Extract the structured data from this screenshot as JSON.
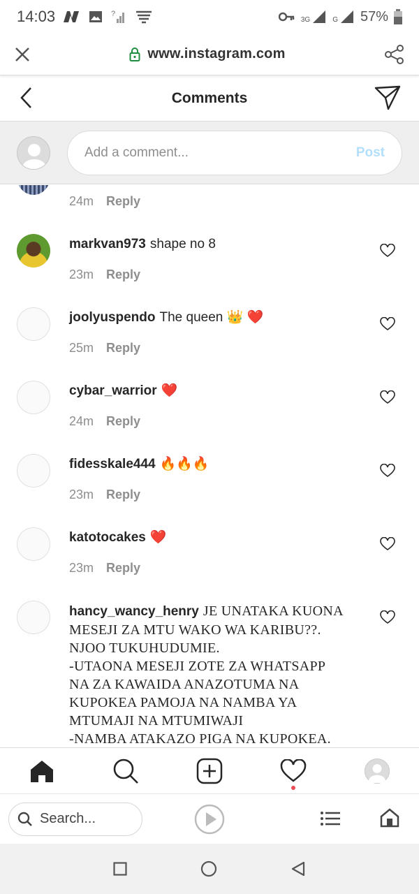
{
  "status_bar": {
    "time": "14:03",
    "network_labels": [
      "3G",
      "G"
    ],
    "battery": "57%"
  },
  "browser": {
    "url": "www.instagram.com",
    "search_placeholder": "Search...",
    "icons": [
      "close-icon",
      "lock-icon",
      "share-icon",
      "search-icon",
      "play-icon",
      "tabs-menu-icon",
      "home-icon"
    ]
  },
  "header": {
    "title": "Comments"
  },
  "add_comment": {
    "placeholder": "Add a comment...",
    "post_label": "Post"
  },
  "first_partial": {
    "time": "24m",
    "reply": "Reply"
  },
  "comments": [
    {
      "username": "markvan973",
      "text": "shape no 8",
      "time": "23m",
      "reply": "Reply"
    },
    {
      "username": "joolyuspendo",
      "text": "The queen 👑 ❤️",
      "time": "25m",
      "reply": "Reply"
    },
    {
      "username": "cybar_warrior",
      "text": "❤️",
      "time": "24m",
      "reply": "Reply"
    },
    {
      "username": "fidesskale444",
      "text": "🔥🔥🔥",
      "time": "23m",
      "reply": "Reply"
    },
    {
      "username": "katotocakes",
      "text": "❤️",
      "time": "23m",
      "reply": "Reply"
    }
  ],
  "long_comment": {
    "username": "hancy_wancy_henry",
    "lines": [
      "JE UNATAKA KUONA",
      "MESEJI ZA MTU WAKO WA KARIBU??.",
      "NJOO TUKUHUDUMIE.",
      "-UTAONA MESEJI ZOTE ZA WHATSAPP",
      "NA ZA KAWAIDA ANAZOTUMA NA",
      "KUPOKEA PAMOJA NA NAMBA YA",
      "MTUMAJI NA MTUMIWAJI",
      "-NAMBA ATAKAZO PIGA NA KUPOKEA."
    ]
  },
  "accent_colors": {
    "post_disabled": "#b2dffc",
    "notification_dot": "#ed4956",
    "lock_green": "#1e8e3e"
  }
}
